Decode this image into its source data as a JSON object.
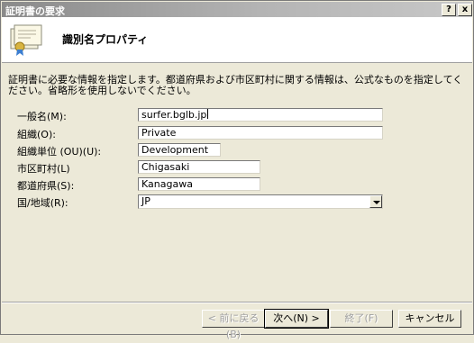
{
  "window": {
    "title": "証明書の要求",
    "help_glyph": "?",
    "close_glyph": "x"
  },
  "header": {
    "title": "識別名プロパティ"
  },
  "description": "証明書に必要な情報を指定します。都道府県および市区町村に関する情報は、公式なものを指定してください。省略形を使用しないでください。",
  "fields": [
    {
      "label": "一般名(M):",
      "value": "surfer.bglb.jp"
    },
    {
      "label": "組織(O):",
      "value": "Private"
    },
    {
      "label": "組織単位 (OU)(U):",
      "value": "Development"
    },
    {
      "label": "市区町村(L)",
      "value": "Chigasaki"
    },
    {
      "label": "都道府県(S):",
      "value": "Kanagawa"
    }
  ],
  "country": {
    "label": "国/地域(R):",
    "selected": "JP"
  },
  "buttons": {
    "back": "< 前に戻る(B)",
    "next": "次へ(N) >",
    "finish": "終了(F)",
    "cancel": "キャンセル"
  }
}
